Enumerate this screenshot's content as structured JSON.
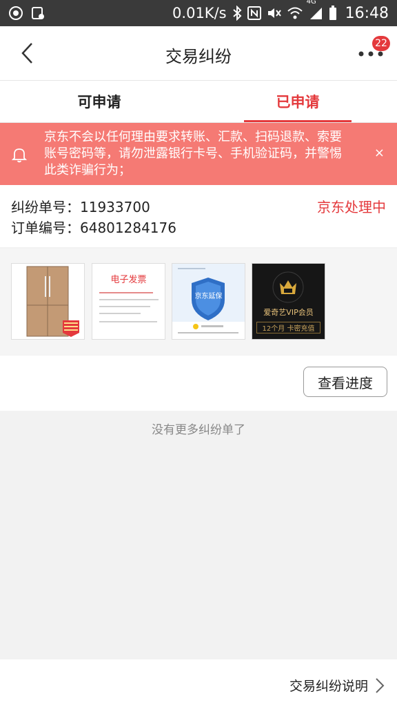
{
  "status_bar": {
    "network_speed": "0.01K/s",
    "net_type": "4G",
    "time": "16:48",
    "icons": [
      "app-icon",
      "clipboard-icon",
      "bluetooth-icon",
      "nfc-icon",
      "mute-icon",
      "wifi-icon",
      "signal-icon",
      "battery-icon"
    ]
  },
  "nav": {
    "title": "交易纠纷",
    "badge_count": "22"
  },
  "tabs": [
    {
      "label": "可申请",
      "active": false
    },
    {
      "label": "已申请",
      "active": true
    }
  ],
  "banner": {
    "text": "京东不会以任何理由要求转账、汇款、扫码退款、索要账号密码等，请勿泄露银行卡号、手机验证码，并警惕此类诈骗行为；",
    "close_label": "×"
  },
  "dispute": {
    "id_label": "纠纷单号：",
    "id_value": "11933700",
    "order_label": "订单编号：",
    "order_value": "64801284176",
    "status": "京东处理中"
  },
  "products": [
    {
      "name": "refrigerator",
      "badge": "30天价保 买1送1 送货上门"
    },
    {
      "name": "e-invoice",
      "title": "电子发票"
    },
    {
      "name": "jd-warranty",
      "title": "京东延保"
    },
    {
      "name": "iqiyi-vip",
      "title": "爱奇艺VIP会员",
      "subtitle": "12个月 卡密充值"
    }
  ],
  "actions": {
    "progress_button": "查看进度"
  },
  "no_more_text": "没有更多纠纷单了",
  "footer": {
    "link_text": "交易纠纷说明"
  },
  "colors": {
    "accent": "#e4393c",
    "banner": "#f57a74"
  }
}
